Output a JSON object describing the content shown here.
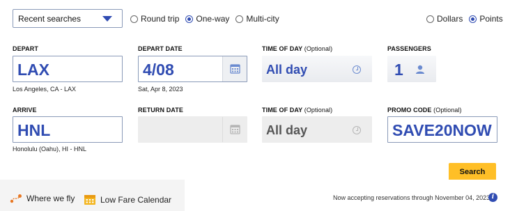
{
  "top": {
    "recent_searches": "Recent searches",
    "trip_types": [
      {
        "label": "Round trip",
        "selected": false
      },
      {
        "label": "One-way",
        "selected": true
      },
      {
        "label": "Multi-city",
        "selected": false
      }
    ],
    "currency": [
      {
        "label": "Dollars",
        "selected": false
      },
      {
        "label": "Points",
        "selected": true
      }
    ]
  },
  "depart": {
    "label": "DEPART",
    "value": "LAX",
    "subtitle": "Los Angeles, CA - LAX"
  },
  "depart_date": {
    "label": "DEPART DATE",
    "value": "4/08",
    "subtitle": "Sat, Apr 8, 2023"
  },
  "time_of_day_1": {
    "label": "TIME OF DAY",
    "optional": "(Optional)",
    "value": "All day"
  },
  "passengers": {
    "label": "PASSENGERS",
    "value": "1"
  },
  "arrive": {
    "label": "ARRIVE",
    "value": "HNL",
    "subtitle": "Honolulu (Oahu), HI - HNL"
  },
  "return_date": {
    "label": "RETURN DATE",
    "value": ""
  },
  "time_of_day_2": {
    "label": "TIME OF DAY",
    "optional": "(Optional)",
    "value": "All day"
  },
  "promo": {
    "label": "PROMO CODE",
    "optional": "(Optional)",
    "value": "SAVE20NOW"
  },
  "search_label": "Search",
  "footer": {
    "where_we_fly": "Where we fly",
    "low_fare_calendar": "Low Fare Calendar",
    "notice": "Now accepting reservations through November 04, 2023.",
    "info_glyph": "i"
  },
  "colors": {
    "accent": "#304cb2",
    "search_button": "#ffbf27",
    "icon_orange": "#e87722"
  }
}
